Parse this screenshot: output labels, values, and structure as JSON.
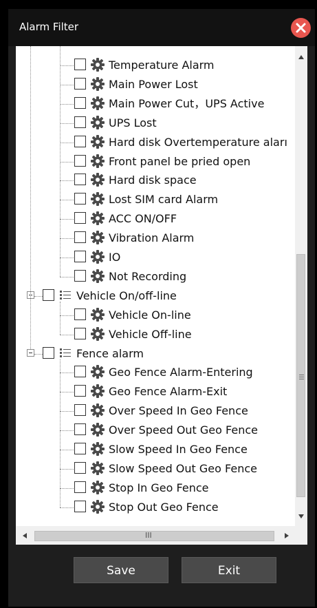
{
  "dialog": {
    "title": "Alarm Filter",
    "close_icon": "close-icon",
    "accent_close": "#e8564f"
  },
  "tree": {
    "top_items": [
      "Temperature Alarm",
      "Main Power Lost",
      "Main Power Cut，UPS Active",
      "UPS Lost",
      "Hard disk Overtemperature aları",
      "Front panel be pried open",
      "Hard disk space",
      "Lost SIM card Alarm",
      "ACC ON/OFF",
      "Vibration Alarm",
      "IO",
      "Not Recording"
    ],
    "groups": [
      {
        "label": "Vehicle On/off-line",
        "items": [
          "Vehicle On-line",
          "Vehicle Off-line"
        ]
      },
      {
        "label": "Fence alarm",
        "items": [
          "Geo Fence Alarm-Entering",
          "Geo Fence Alarm-Exit",
          "Over Speed In Geo Fence",
          "Over Speed Out Geo Fence",
          "Slow Speed In Geo Fence",
          "Slow Speed Out Geo Fence",
          "Stop In Geo Fence",
          "Stop Out Geo Fence"
        ]
      }
    ]
  },
  "scrollbar": {
    "h_thumb_label": "III",
    "v_thumb_label": "≡"
  },
  "buttons": {
    "save": "Save",
    "exit": "Exit"
  }
}
